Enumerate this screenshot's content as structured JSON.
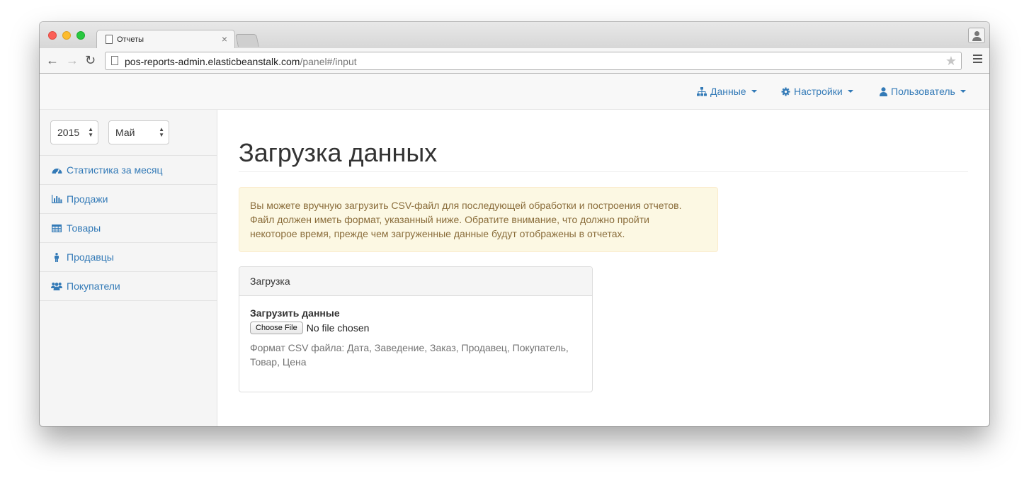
{
  "browser": {
    "tab_title": "Отчеты",
    "tab_close": "×",
    "url_host": "pos-reports-admin.elasticbeanstalk.com",
    "url_path": "/panel#/input",
    "back": "←",
    "forward": "→",
    "reload": "↻",
    "star": "★"
  },
  "navbar": {
    "data_label": "Данные",
    "settings_label": "Настройки",
    "user_label": "Пользователь"
  },
  "sidebar": {
    "year": "2015",
    "month": "Май",
    "items": [
      {
        "label": "Статистика за месяц",
        "icon": "dashboard-icon"
      },
      {
        "label": "Продажи",
        "icon": "bar-chart-icon"
      },
      {
        "label": "Товары",
        "icon": "table-icon"
      },
      {
        "label": "Продавцы",
        "icon": "male-icon"
      },
      {
        "label": "Покупатели",
        "icon": "users-icon"
      }
    ]
  },
  "main": {
    "title": "Загрузка данных",
    "alert_lines": [
      "Вы можете вручную загрузить CSV-файл для последующей обработки и построения отчетов.",
      "Файл должен иметь формат, указанный ниже. Обратите внимание, что должно пройти",
      "некоторое время, прежде чем загруженные данные будут отображены в отчетах."
    ],
    "panel": {
      "heading": "Загрузка",
      "field_label": "Загрузить данные",
      "choose_file": "Choose File",
      "file_status": "No file chosen",
      "help_lines": [
        "Формат CSV файла: Дата, Заведение, Заказ, Продавец, Покупатель,",
        "Товар, Цена"
      ]
    }
  },
  "colors": {
    "link": "#337ab7",
    "alert_bg": "#fcf8e3",
    "alert_text": "#8a6d3b"
  }
}
